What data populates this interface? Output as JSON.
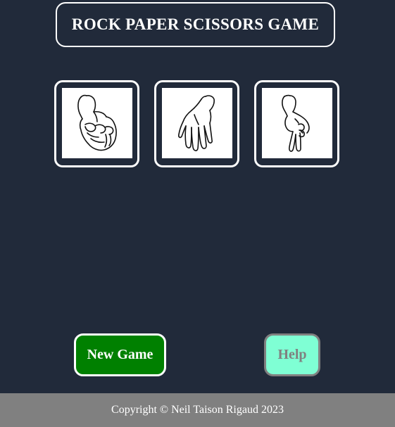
{
  "header": {
    "title": "ROCK PAPER SCISSORS GAME"
  },
  "choices": [
    {
      "id": "rock",
      "icon": "rock-fist-icon"
    },
    {
      "id": "paper",
      "icon": "paper-open-hand-icon"
    },
    {
      "id": "scissors",
      "icon": "scissors-hand-icon"
    }
  ],
  "controls": {
    "new_game_label": "New Game",
    "help_label": "Help"
  },
  "footer": {
    "copyright": "Copyright © Neil Taison Rigaud 2023"
  },
  "colors": {
    "background": "#212a3a",
    "new_game_bg": "#008000",
    "help_bg": "#7fffd4",
    "footer_bg": "#808080"
  }
}
